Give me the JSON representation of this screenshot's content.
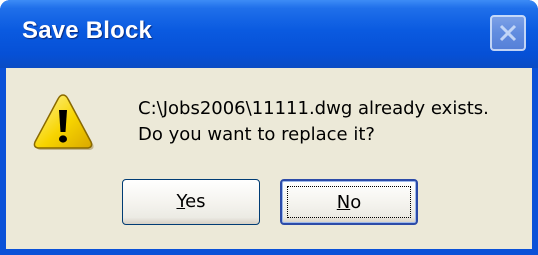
{
  "window": {
    "title": "Save Block"
  },
  "dialog": {
    "icon": "warning-icon",
    "message_line1": "C:\\Jobs2006\\11111.dwg already exists.",
    "message_line2": "Do you want to replace it?"
  },
  "buttons": {
    "yes": {
      "accel": "Y",
      "rest": "es"
    },
    "no": {
      "accel": "N",
      "rest": "o"
    }
  },
  "colors": {
    "titlebar": "#0a5ae0",
    "client_bg": "#ece9d8",
    "warning_fill": "#f5d000"
  }
}
